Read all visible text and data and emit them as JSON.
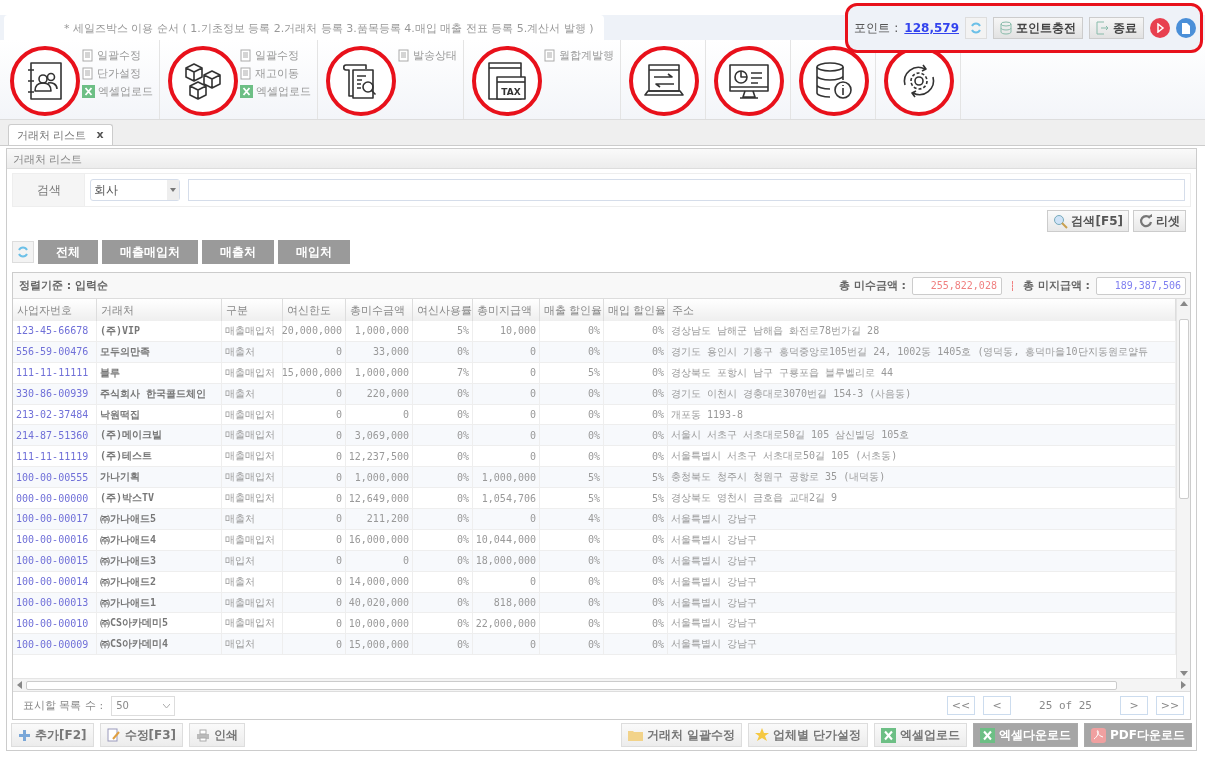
{
  "notice": "* 세일즈박스 이용 순서 ( 1.기초정보 등록  2.거래처 등록  3.품목등록  4.매입 매출 전표 등록  5.계산서 발행 )",
  "points": {
    "label": "포인트 :",
    "value": "128,579",
    "charge_button": "포인트충전",
    "exit_button": "종료"
  },
  "toolbar": [
    {
      "items": [
        {
          "label": "일괄수정",
          "kind": "doc"
        },
        {
          "label": "단가설정",
          "kind": "doc"
        },
        {
          "label": "엑셀업로드",
          "kind": "excel"
        }
      ]
    },
    {
      "items": [
        {
          "label": "일괄수정",
          "kind": "doc"
        },
        {
          "label": "재고이동",
          "kind": "doc"
        },
        {
          "label": "엑셀업로드",
          "kind": "excel"
        }
      ]
    },
    {
      "items": [
        {
          "label": "발송상태",
          "kind": "doc"
        }
      ]
    },
    {
      "icon_text": "TAX",
      "items": [
        {
          "label": "월합계발행",
          "kind": "doc"
        }
      ]
    }
  ],
  "tab": {
    "label": "거래처 리스트",
    "close": "x"
  },
  "panel_title": "거래처 리스트",
  "search": {
    "label": "검색",
    "select": "회사",
    "search_button": "검색[F5]",
    "reset_button": "리셋"
  },
  "filters": [
    "전체",
    "매출매입처",
    "매출처",
    "매입처"
  ],
  "sort": "정렬기준 : 입력순",
  "totals": [
    {
      "label": "총 미수금액 :",
      "value": "255,822,028",
      "color": "#f08080"
    },
    {
      "label": "총 미지급액 :",
      "value": "189,387,506",
      "color": "#8080f0"
    }
  ],
  "table": {
    "columns": [
      "사업자번호",
      "거래처",
      "구분",
      "여신한도",
      "총미수금액",
      "여신사용률",
      "총미지급액",
      "매출 할인율",
      "매입 할인율",
      "주소"
    ],
    "rows": [
      [
        "123-45-66678",
        "(주)VIP",
        "매출매입처",
        "20,000,000",
        "1,000,000",
        "5%",
        "10,000",
        "0%",
        "0%",
        "경상남도 남해군 남해읍 화전로78번가길 28"
      ],
      [
        "556-59-00476",
        "모두의만족",
        "매출처",
        "0",
        "33,000",
        "0%",
        "0",
        "0%",
        "0%",
        "경기도 용인시 기흥구 흥덕중앙로105번길 24, 1002동 1405호 (영덕동, 흥덕마을10단지동원로얄듀"
      ],
      [
        "111-11-11111",
        "블루",
        "매출매입처",
        "15,000,000",
        "1,000,000",
        "7%",
        "0",
        "5%",
        "0%",
        "경상북도 포항시 남구 구룡포읍 블루벨리로 44"
      ],
      [
        "330-86-00939",
        "주식회사 한국콜드체인",
        "매출처",
        "0",
        "220,000",
        "0%",
        "0",
        "0%",
        "0%",
        "경기도 이천시 경충대로3070번길 154-3 (사음동)"
      ],
      [
        "213-02-37484",
        "낙원떡집",
        "매출매입처",
        "0",
        "0",
        "0%",
        "0",
        "0%",
        "0%",
        "개포동 1193-8"
      ],
      [
        "214-87-51360",
        "(주)메이크빌",
        "매출매입처",
        "0",
        "3,069,000",
        "0%",
        "0",
        "0%",
        "0%",
        "서울시 서초구 서초대로50길 105 삼신빌딩 105호"
      ],
      [
        "111-11-11119",
        "(주)테스트",
        "매출매입처",
        "0",
        "12,237,500",
        "0%",
        "0",
        "0%",
        "0%",
        "서울특별시 서초구 서초대로50길 105 (서초동)"
      ],
      [
        "100-00-00555",
        "가나기획",
        "매출매입처",
        "0",
        "1,000,000",
        "0%",
        "1,000,000",
        "5%",
        "5%",
        "충청북도 청주시 청원구 공항로 35 (내덕동)"
      ],
      [
        "000-00-00000",
        "(주)박스TV",
        "매출매입처",
        "0",
        "12,649,000",
        "0%",
        "1,054,706",
        "5%",
        "5%",
        "경상북도 영천시 금호읍 교대2길 9"
      ],
      [
        "100-00-00017",
        "㈜가나애드5",
        "매출처",
        "0",
        "211,200",
        "0%",
        "0",
        "4%",
        "0%",
        "서울특별시 강남구"
      ],
      [
        "100-00-00016",
        "㈜가나애드4",
        "매출매입처",
        "0",
        "16,000,000",
        "0%",
        "10,044,000",
        "0%",
        "0%",
        "서울특별시 강남구"
      ],
      [
        "100-00-00015",
        "㈜가나애드3",
        "매입처",
        "0",
        "0",
        "0%",
        "18,000,000",
        "0%",
        "0%",
        "서울특별시 강남구"
      ],
      [
        "100-00-00014",
        "㈜가나애드2",
        "매출처",
        "0",
        "14,000,000",
        "0%",
        "0",
        "0%",
        "0%",
        "서울특별시 강남구"
      ],
      [
        "100-00-00013",
        "㈜가나애드1",
        "매출매입처",
        "0",
        "40,020,000",
        "0%",
        "818,000",
        "0%",
        "0%",
        "서울특별시 강남구"
      ],
      [
        "100-00-00010",
        "㈜CS아카데미5",
        "매출매입처",
        "0",
        "10,000,000",
        "0%",
        "22,000,000",
        "0%",
        "0%",
        "서울특별시 강남구"
      ],
      [
        "100-00-00009",
        "㈜CS아카데미4",
        "매입처",
        "0",
        "15,000,000",
        "0%",
        "0",
        "0%",
        "0%",
        "서울특별시 강남구"
      ]
    ]
  },
  "page_size": {
    "label": "표시할 목록 수 :",
    "value": "50"
  },
  "pager": {
    "first": "<<",
    "prev": "<",
    "info": "25 of 25",
    "next": ">",
    "last": ">>"
  },
  "left_buttons": [
    {
      "label": "추가[F2]",
      "kind": "add"
    },
    {
      "label": "수정[F3]",
      "kind": "edit"
    },
    {
      "label": "인쇄",
      "kind": "print"
    }
  ],
  "right_buttons": [
    {
      "label": "거래처 일괄수정",
      "kind": "folder",
      "disabled": false
    },
    {
      "label": "업체별 단가설정",
      "kind": "star",
      "disabled": false
    },
    {
      "label": "엑셀업로드",
      "kind": "excel",
      "disabled": false
    },
    {
      "label": "엑셀다운로드",
      "kind": "excel",
      "disabled": true
    },
    {
      "label": "PDF다운로드",
      "kind": "pdf",
      "disabled": true
    }
  ]
}
